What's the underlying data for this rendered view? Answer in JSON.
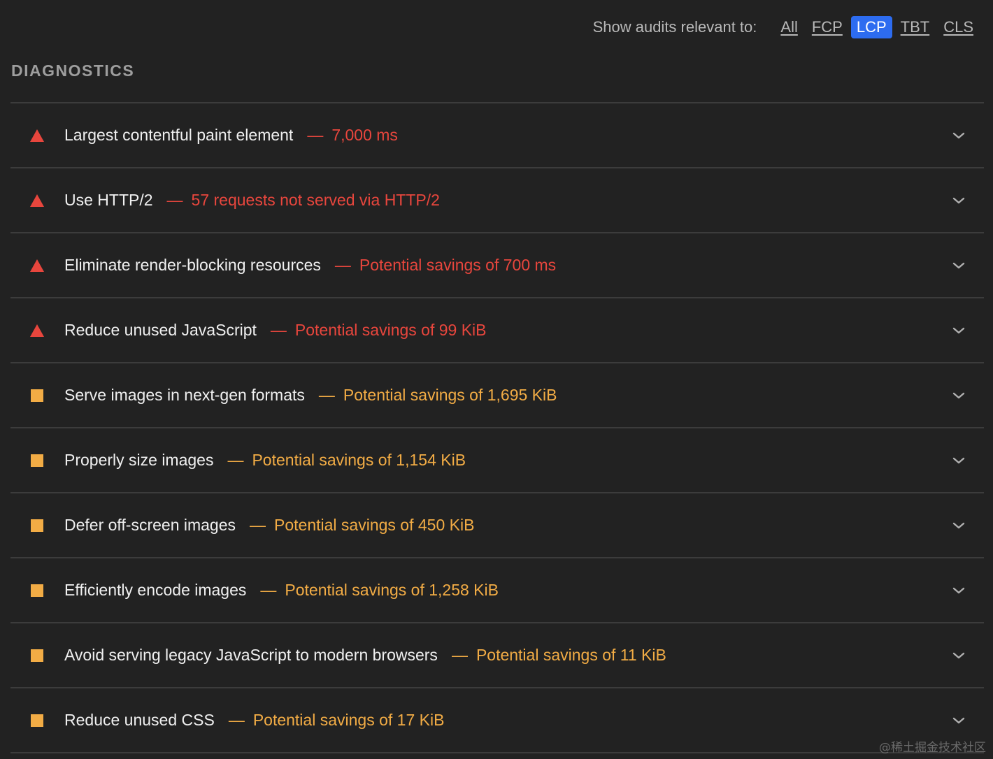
{
  "filter": {
    "label": "Show audits relevant to:",
    "options": [
      {
        "label": "All",
        "active": false
      },
      {
        "label": "FCP",
        "active": false
      },
      {
        "label": "LCP",
        "active": true
      },
      {
        "label": "TBT",
        "active": false
      },
      {
        "label": "CLS",
        "active": false
      }
    ]
  },
  "section": {
    "title": "DIAGNOSTICS"
  },
  "colors": {
    "fail": "#e8463d",
    "average": "#f2ac45",
    "active_filter": "#2d6cf0"
  },
  "audits": [
    {
      "status": "fail",
      "title": "Largest contentful paint element",
      "separator": "—",
      "display": "7,000 ms"
    },
    {
      "status": "fail",
      "title": "Use HTTP/2",
      "separator": "—",
      "display": "57 requests not served via HTTP/2"
    },
    {
      "status": "fail",
      "title": "Eliminate render-blocking resources",
      "separator": "—",
      "display": "Potential savings of 700 ms"
    },
    {
      "status": "fail",
      "title": "Reduce unused JavaScript",
      "separator": "—",
      "display": "Potential savings of 99 KiB"
    },
    {
      "status": "average",
      "title": "Serve images in next-gen formats",
      "separator": "—",
      "display": "Potential savings of 1,695 KiB"
    },
    {
      "status": "average",
      "title": "Properly size images",
      "separator": "—",
      "display": "Potential savings of 1,154 KiB"
    },
    {
      "status": "average",
      "title": "Defer off-screen images",
      "separator": "—",
      "display": "Potential savings of 450 KiB"
    },
    {
      "status": "average",
      "title": "Efficiently encode images",
      "separator": "—",
      "display": "Potential savings of 1,258 KiB"
    },
    {
      "status": "average",
      "title": "Avoid serving legacy JavaScript to modern browsers",
      "separator": "—",
      "display": "Potential savings of 11 KiB"
    },
    {
      "status": "average",
      "title": "Reduce unused CSS",
      "separator": "—",
      "display": "Potential savings of 17 KiB"
    }
  ],
  "watermark": "@稀土掘金技术社区"
}
